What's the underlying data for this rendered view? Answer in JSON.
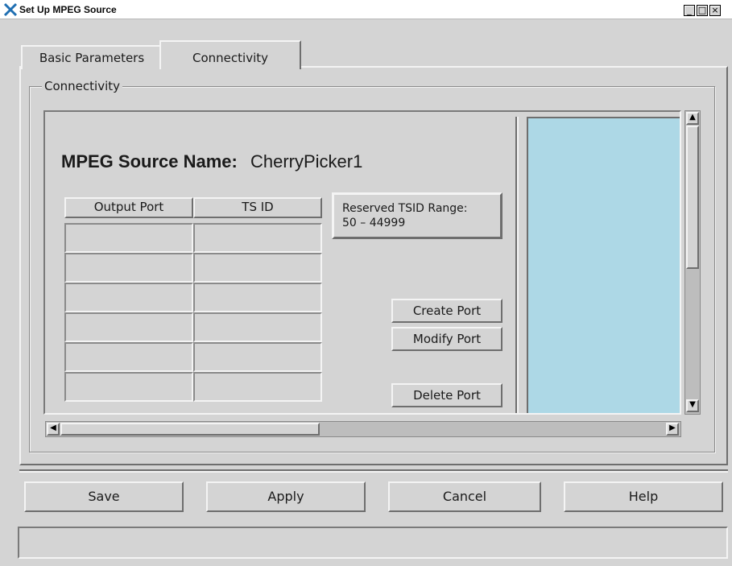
{
  "window": {
    "title": "Set Up MPEG Source",
    "minimize_label": "_",
    "maximize_label": "□",
    "close_label": "×"
  },
  "tabs": [
    {
      "label": "Basic Parameters",
      "active": false
    },
    {
      "label": "Connectivity",
      "active": true
    }
  ],
  "group": {
    "label": "Connectivity"
  },
  "source": {
    "name_label": "MPEG Source Name:",
    "name_value": "CherryPicker1"
  },
  "table": {
    "headers": [
      "Output Port",
      "TS ID"
    ],
    "rows": [
      [
        "",
        ""
      ],
      [
        "",
        ""
      ],
      [
        "",
        ""
      ],
      [
        "",
        ""
      ],
      [
        "",
        ""
      ],
      [
        "",
        ""
      ]
    ]
  },
  "tsid_range": {
    "label": "Reserved TSID Range:",
    "value": "50 – 44999"
  },
  "port_buttons": {
    "create": "Create Port",
    "modify": "Modify Port",
    "delete": "Delete Port"
  },
  "list_panel": {
    "background": "#add8e6"
  },
  "vscroll": {
    "up_arrow": "▲",
    "down_arrow": "▼"
  },
  "hscroll": {
    "left_arrow": "◀",
    "right_arrow": "▶"
  },
  "footer": {
    "save": "Save",
    "apply": "Apply",
    "cancel": "Cancel",
    "help": "Help"
  },
  "status_bar": {
    "text": ""
  }
}
